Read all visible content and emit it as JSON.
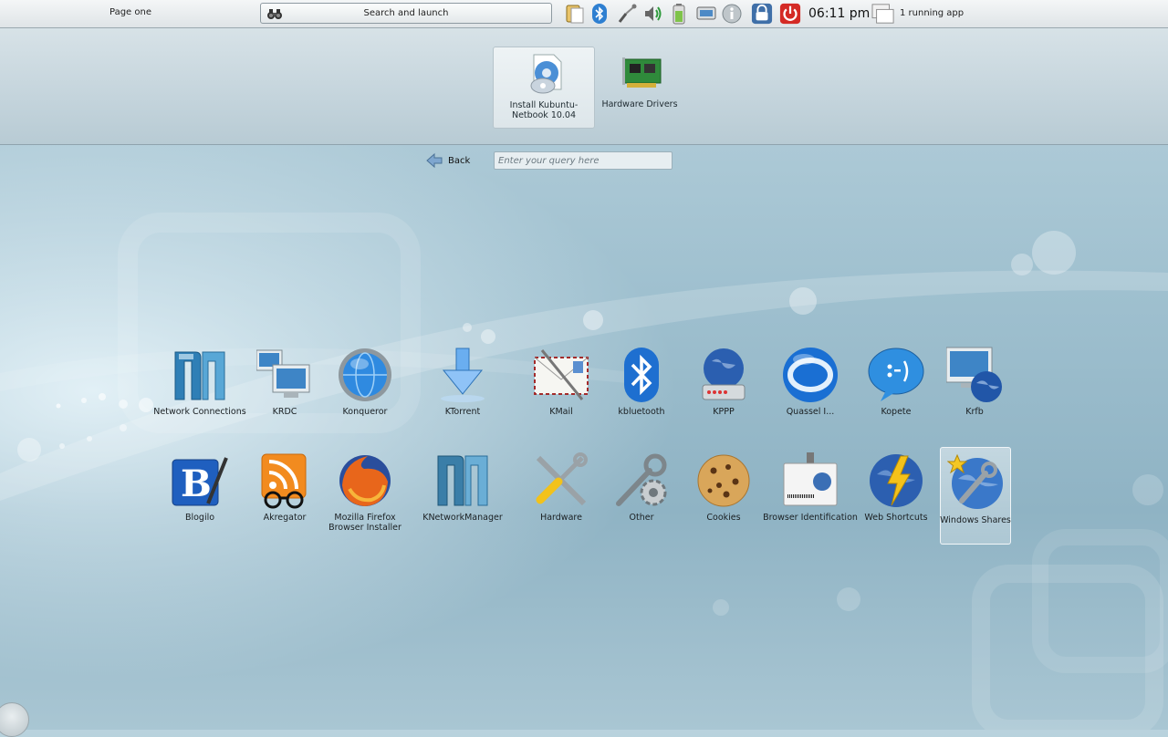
{
  "topbar": {
    "page_label": "Page one",
    "search_launch_label": "Search and launch",
    "clock": "06:11 pm",
    "running_apps": "1 running app"
  },
  "favorites": [
    {
      "label": "Install Kubuntu-Netbook 10.04",
      "icon": "installer-cd-icon",
      "selected": true
    },
    {
      "label": "Hardware Drivers",
      "icon": "pci-card-icon",
      "selected": false
    }
  ],
  "nav": {
    "back_label": "Back",
    "query_placeholder": "Enter your query here"
  },
  "apps_row1": [
    {
      "label": "Network Connections",
      "icon": "network-manager-icon"
    },
    {
      "label": "KRDC",
      "icon": "remote-desktop-icon"
    },
    {
      "label": "Konqueror",
      "icon": "konqueror-globe-icon"
    },
    {
      "label": "KTorrent",
      "icon": "download-arrow-icon"
    },
    {
      "label": "KMail",
      "icon": "mail-envelope-icon"
    },
    {
      "label": "kbluetooth",
      "icon": "bluetooth-icon"
    },
    {
      "label": "KPPP",
      "icon": "modem-globe-icon"
    },
    {
      "label": "Quassel I...",
      "icon": "quassel-irc-icon"
    },
    {
      "label": "Kopete",
      "icon": "chat-bubble-icon"
    },
    {
      "label": "Krfb",
      "icon": "desktop-sharing-icon"
    }
  ],
  "apps_row2": [
    {
      "label": "Blogilo",
      "icon": "blog-b-icon"
    },
    {
      "label": "Akregator",
      "icon": "rss-reader-icon"
    },
    {
      "label": "Mozilla Firefox Browser Installer",
      "icon": "firefox-icon"
    },
    {
      "label": "KNetworkManager",
      "icon": "network-manager-icon"
    },
    {
      "label": "Hardware",
      "icon": "tools-icon"
    },
    {
      "label": "Other",
      "icon": "wrench-gear-icon"
    },
    {
      "label": "Cookies",
      "icon": "cookie-icon"
    },
    {
      "label": "Browser Identification",
      "icon": "id-badge-icon"
    },
    {
      "label": "Web Shortcuts",
      "icon": "web-shortcut-icon"
    },
    {
      "label": "Windows Shares",
      "icon": "windows-shares-icon",
      "selected": true
    }
  ],
  "colors": {
    "accent_blue": "#2e7fd1",
    "power_red": "#d42a25"
  }
}
